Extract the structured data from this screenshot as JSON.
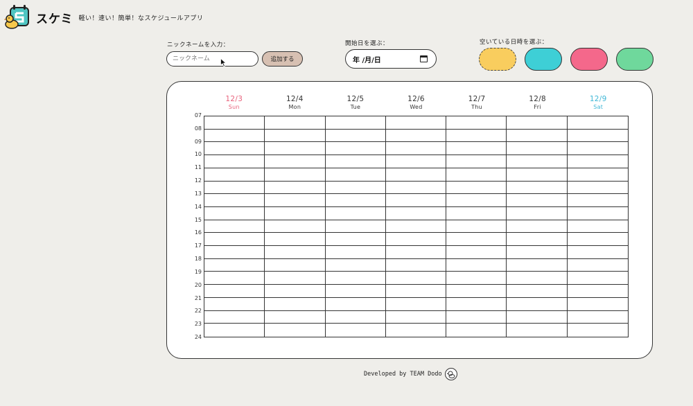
{
  "app": {
    "name": "スケミ",
    "tagline": "軽い！速い！簡単！なスケジュールアプリ"
  },
  "controls": {
    "nickname_label": "ニックネームを入力：",
    "nickname_placeholder": "ニックネーム",
    "add_button": "追加する",
    "start_date_label": "開始日を選ぶ：",
    "start_date_value": "年 /月/日",
    "availability_label": "空いている日時を選ぶ：",
    "colors": [
      {
        "name": "yellow",
        "hex": "#f9cd5e",
        "selected": true
      },
      {
        "name": "cyan",
        "hex": "#3ecfd6",
        "selected": false
      },
      {
        "name": "pink",
        "hex": "#f4688b",
        "selected": false
      },
      {
        "name": "green",
        "hex": "#6fd89c",
        "selected": false
      }
    ]
  },
  "calendar": {
    "days": [
      {
        "date": "12/3",
        "weekday": "Sun",
        "color": "#e8627c"
      },
      {
        "date": "12/4",
        "weekday": "Mon",
        "color": "#333333"
      },
      {
        "date": "12/5",
        "weekday": "Tue",
        "color": "#333333"
      },
      {
        "date": "12/6",
        "weekday": "Wed",
        "color": "#333333"
      },
      {
        "date": "12/7",
        "weekday": "Thu",
        "color": "#333333"
      },
      {
        "date": "12/8",
        "weekday": "Fri",
        "color": "#333333"
      },
      {
        "date": "12/9",
        "weekday": "Sat",
        "color": "#3fb7d6"
      }
    ],
    "hours": [
      "07",
      "08",
      "09",
      "10",
      "11",
      "12",
      "13",
      "14",
      "15",
      "16",
      "17",
      "18",
      "19",
      "20",
      "21",
      "22",
      "23",
      "24"
    ]
  },
  "footer": {
    "text": "Developed by TEAM Dodo"
  }
}
